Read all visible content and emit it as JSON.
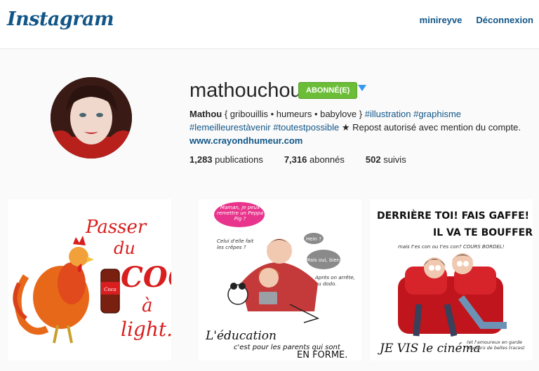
{
  "header": {
    "logo_text": "Instagram",
    "nav": {
      "username": "minireyve",
      "logout": "Déconnexion"
    }
  },
  "profile": {
    "username": "mathouchou",
    "follow_button": "ABONNÉ(E)",
    "bio": {
      "name": "Mathou",
      "line1_rest": " { gribouillis • humeurs • babylove } ",
      "tag_illustration": "#illustration",
      "tag_graphisme": "#graphisme",
      "tag_lemeilleur": "#lemeilleurestàvenir",
      "tag_toutest": "#toutestpossible",
      "line2_rest": " ★ Repost autorisé avec mention du compte.",
      "website": "www.crayondhumeur.com"
    },
    "stats": {
      "posts_count": "1,283",
      "posts_label": " publications",
      "followers_count": "7,316",
      "followers_label": " abonnés",
      "following_count": "502",
      "following_label": " suivis"
    }
  },
  "posts": [
    {
      "lines": [
        "Passer",
        "du",
        "COQ",
        "à",
        "light."
      ]
    },
    {
      "bubble1": "Maman, je peux remettre un Peppa Pig ?",
      "bubble2": "Hein ?",
      "bubble3": "Mais oui, bien.",
      "side1": "Celui d'elle fait les crêpes ?",
      "side2": "Après on arrête, au dodo.",
      "caption1": "L'éducation",
      "caption2": "c'est pour les parents qui sont",
      "caption3": "EN FORME."
    },
    {
      "line1": "DERRIÈRE TOI! FAIS GAFFE!",
      "line2": "IL VA TE BOUFFER!",
      "line3": "mais t'es con ou t'es con? COURS BORDEL!",
      "caption": "JE VIS le cinéma",
      "note": "(et l'amoureux en garde toujours de belles traces)"
    }
  ],
  "colors": {
    "link": "#125688",
    "follow_green": "#6bbd37",
    "dropdown_blue": "#3897f0"
  }
}
